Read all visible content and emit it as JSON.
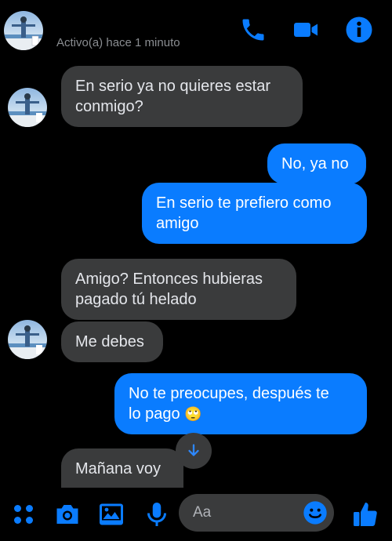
{
  "header": {
    "status": "Activo(a) hace 1 minuto",
    "icons": [
      "phone-icon",
      "video-camera-icon",
      "info-icon"
    ]
  },
  "messages": [
    {
      "side": "in",
      "text_lines": [
        "En serio ya no quieres estar",
        "conmigo?"
      ]
    },
    {
      "side": "out",
      "text_lines": [
        "No, ya no"
      ]
    },
    {
      "side": "out",
      "text_lines": [
        "En serio te prefiero como",
        "amigo"
      ]
    },
    {
      "side": "in",
      "text_lines": [
        "Amigo? Entonces hubieras",
        "pagado tú helado"
      ]
    },
    {
      "side": "in",
      "text_lines": [
        "Me debes"
      ]
    },
    {
      "side": "out",
      "text_lines": [
        "No te preocupes, después te",
        "lo pago"
      ],
      "emoji": "🙄"
    },
    {
      "side": "in",
      "text_lines": [
        "Mañana voy"
      ]
    }
  ],
  "composer": {
    "placeholder": "Aa"
  },
  "colors": {
    "accent": "#0a7cff",
    "incoming_bubble": "#3a3b3c",
    "background": "#000000"
  }
}
